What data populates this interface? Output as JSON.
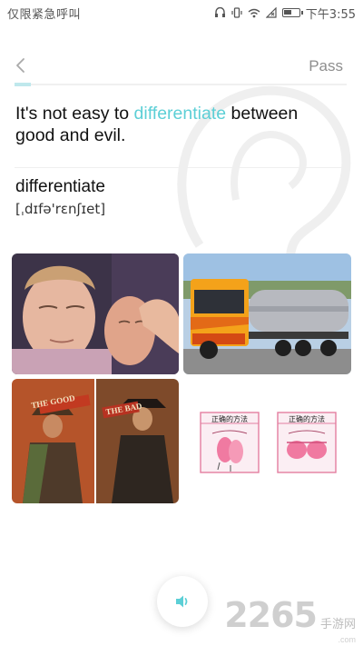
{
  "status_bar": {
    "carrier": "仅限紧急呼叫",
    "time": "下午3:55"
  },
  "header": {
    "back_icon": "chevron-left-icon",
    "pass_label": "Pass",
    "progress": 0.05
  },
  "sentence": {
    "before": "It's not easy to ",
    "highlight": "differentiate",
    "after": " between good and evil."
  },
  "word": {
    "text": "differentiate",
    "phonetic": "[ˌdɪfə'rɛnʃɪet]"
  },
  "images": [
    {
      "name": "image-option-faces"
    },
    {
      "name": "image-option-truck"
    },
    {
      "name": "image-option-good-bad",
      "label_left": "THE GOOD",
      "label_right": "THE BAD"
    },
    {
      "name": "image-option-method",
      "caption_left": "正确的方法",
      "caption_right": "正确的方法"
    }
  ],
  "speaker": {
    "icon": "speaker-icon"
  },
  "watermark_brand": {
    "number": "2265",
    "text": "手游网",
    "url": ".com"
  },
  "colors": {
    "accent": "#5ccfd6",
    "progress": "#bfe8ec"
  }
}
